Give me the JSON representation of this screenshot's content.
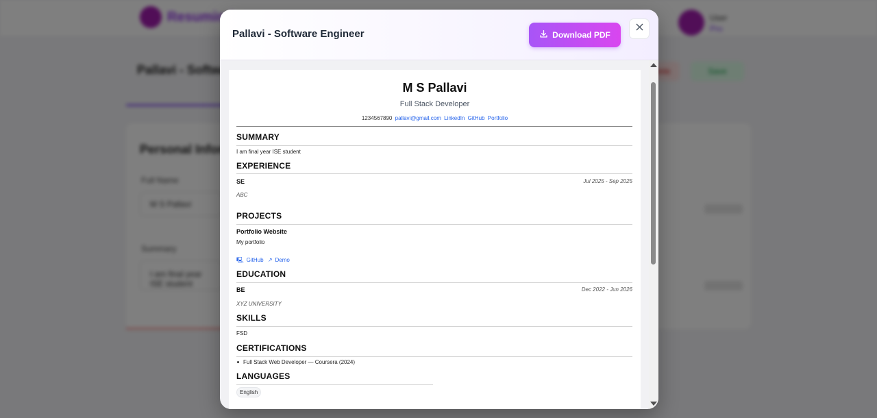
{
  "background": {
    "brand": "Resumind",
    "user_name": "User",
    "user_sub": "Pro",
    "page_title": "Pallavi - Software Engineer",
    "delete_label": "Delete",
    "save_label": "Save",
    "card_title": "Personal Information",
    "field1_label": "Full Name",
    "field1_value": "M S Pallavi",
    "field2_label": "Summary",
    "field2_value": "I am final year ISE student"
  },
  "modal": {
    "title": "Pallavi - Software Engineer",
    "download_label": "Download PDF",
    "colors": {
      "accent_start": "#a855f7",
      "accent_end": "#d946ef"
    }
  },
  "resume": {
    "name": "M S Pallavi",
    "role": "Full Stack Developer",
    "phone": "1234567890",
    "email": "pallavi@gmail.com",
    "links": [
      "LinkedIn",
      "GitHub",
      "Portfolio"
    ],
    "summary": {
      "heading": "SUMMARY",
      "text": "I am final year ISE student"
    },
    "experience": {
      "heading": "EXPERIENCE",
      "items": [
        {
          "title": "SE",
          "company": "ABC",
          "dates": "Jul 2025 - Sep 2025"
        }
      ]
    },
    "projects": {
      "heading": "PROJECTS",
      "items": [
        {
          "name": "Portfolio Website",
          "description": "My portfolio",
          "github": "GitHub",
          "demo": "Demo"
        }
      ]
    },
    "education": {
      "heading": "EDUCATION",
      "items": [
        {
          "degree": "BE",
          "school": "XYZ UNIVERSITY",
          "dates": "Dec 2022 - Jun 2026"
        }
      ]
    },
    "skills": {
      "heading": "SKILLS",
      "text": "FSD"
    },
    "certifications": {
      "heading": "CERTIFICATIONS",
      "items": [
        "Full Stack Web Developer — Coursera (2024)"
      ]
    },
    "languages": {
      "heading": "LANGUAGES",
      "items": [
        "English"
      ]
    }
  },
  "icons": [
    "download-icon",
    "close-icon",
    "github-icon",
    "external-link-icon"
  ]
}
